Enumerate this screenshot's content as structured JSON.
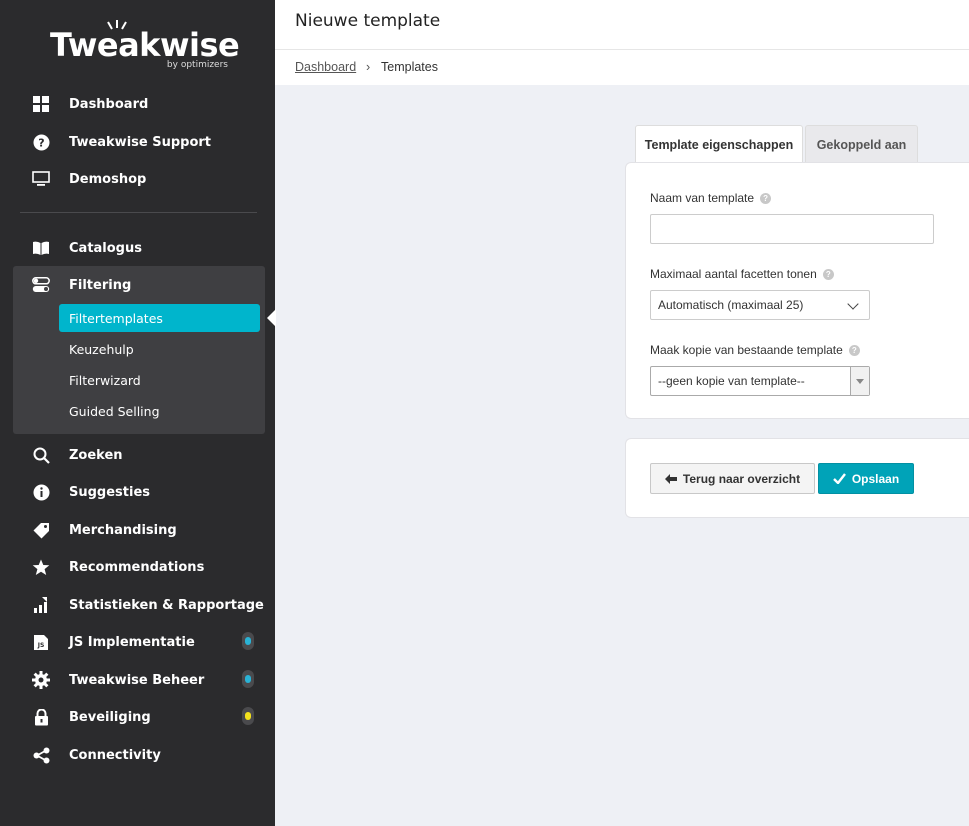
{
  "brand": {
    "name": "Tweakwise",
    "tagline": "by optimizers"
  },
  "sidebar": {
    "top_items": [
      {
        "label": "Dashboard",
        "icon": "grid-icon"
      },
      {
        "label": "Tweakwise Support",
        "icon": "question-circle-icon"
      },
      {
        "label": "Demoshop",
        "icon": "monitor-icon"
      }
    ],
    "catalogus": {
      "label": "Catalogus",
      "icon": "book-icon"
    },
    "filtering": {
      "label": "Filtering",
      "icon": "toggle-icon",
      "sub_items": [
        "Filtertemplates",
        "Keuzehulp",
        "Filterwizard",
        "Guided Selling"
      ],
      "active_sub": "Filtertemplates"
    },
    "bottom_items": [
      {
        "label": "Zoeken",
        "icon": "search-icon"
      },
      {
        "label": "Suggesties",
        "icon": "info-circle-icon"
      },
      {
        "label": "Merchandising",
        "icon": "tag-icon"
      },
      {
        "label": "Recommendations",
        "icon": "star-icon"
      },
      {
        "label": "Statistieken & Rapportage",
        "icon": "chart-icon"
      },
      {
        "label": "JS Implementatie",
        "icon": "js-icon",
        "badge_color": "#2ab3d6"
      },
      {
        "label": "Tweakwise Beheer",
        "icon": "gear-icon",
        "badge_color": "#2ab3d6"
      },
      {
        "label": "Beveiliging",
        "icon": "lock-icon",
        "badge_color": "#f3e11c"
      },
      {
        "label": "Connectivity",
        "icon": "share-icon"
      }
    ]
  },
  "header": {
    "title": "Nieuwe template"
  },
  "breadcrumb": {
    "link": "Dashboard",
    "separator": "›",
    "current": "Templates"
  },
  "tabs": [
    {
      "label": "Template eigenschappen",
      "active": true
    },
    {
      "label": "Gekoppeld aan",
      "active": false
    }
  ],
  "form": {
    "name_label": "Naam van template",
    "name_value": "",
    "facets_label": "Maximaal aantal facetten tonen",
    "facets_value": "Automatisch (maximaal 25)",
    "copy_label": "Maak kopie van bestaande template",
    "copy_value": "--geen kopie van template--",
    "help_glyph": "?"
  },
  "actions": {
    "back_label": "Terug naar overzicht",
    "save_label": "Opslaan"
  },
  "colors": {
    "sidebar_bg": "#2b2b2d",
    "accent": "#00b5cc",
    "save_button": "#00a3b8"
  }
}
